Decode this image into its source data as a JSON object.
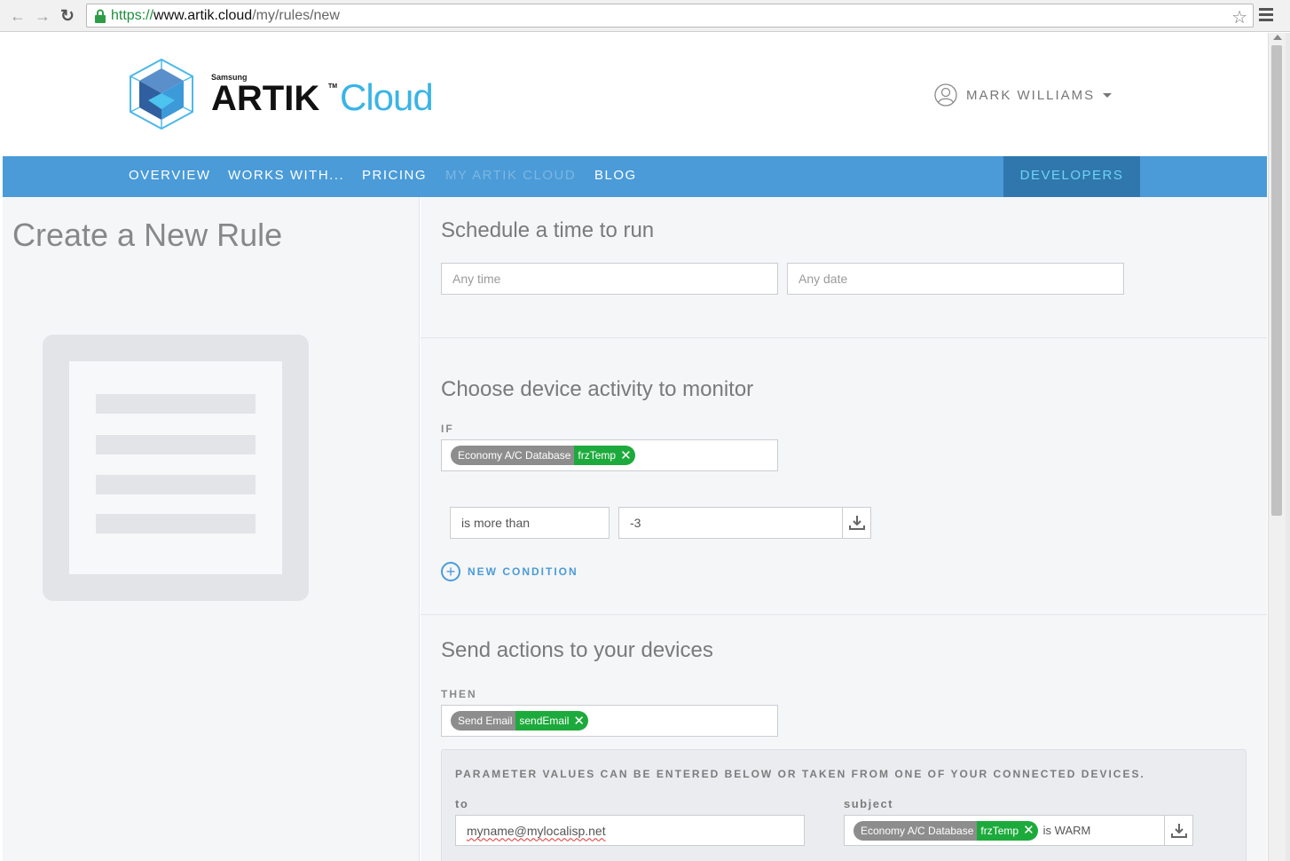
{
  "browser": {
    "url_scheme": "https://",
    "url_host": "www.artik.cloud",
    "url_path": "/my/rules/new"
  },
  "header": {
    "brand_samsung": "Samsung",
    "brand_artik": "ARTIK",
    "brand_tm": "TM",
    "brand_cloud": "Cloud",
    "user_name": "MARK WILLIAMS"
  },
  "nav": {
    "items": [
      "OVERVIEW",
      "WORKS WITH...",
      "PRICING",
      "MY ARTIK CLOUD",
      "BLOG"
    ],
    "active": "MY ARTIK CLOUD",
    "developers": "DEVELOPERS"
  },
  "left": {
    "page_title": "Create a New Rule"
  },
  "schedule": {
    "title": "Schedule a time to run",
    "time_placeholder": "Any time",
    "date_placeholder": "Any date"
  },
  "monitor": {
    "title": "Choose device activity to monitor",
    "if_label": "IF",
    "device": "Economy A/C Database",
    "field": "frzTemp",
    "operator": "is more than",
    "value": "-3",
    "new_condition": "NEW CONDITION"
  },
  "actions": {
    "title": "Send actions to your devices",
    "then_label": "THEN",
    "device": "Send Email",
    "action": "sendEmail",
    "param_note": "PARAMETER VALUES CAN BE ENTERED BELOW OR TAKEN FROM ONE OF YOUR CONNECTED DEVICES.",
    "to_label": "to",
    "to_value": "myname@mylocalisp.net",
    "subject_label": "subject",
    "subject_device": "Economy A/C Database",
    "subject_field": "frzTemp",
    "subject_suffix": "is WARM"
  },
  "colors": {
    "nav_bg": "#4a9bd8",
    "developers_bg": "#2f77ad",
    "chip_green": "#1daa3c",
    "chip_grey": "#8d8d8d",
    "brand_cloud": "#3ab4e6"
  },
  "icons": [
    "back-icon",
    "forward-icon",
    "reload-icon",
    "lock-icon",
    "star-icon",
    "menu-icon",
    "cube-logo-icon",
    "user-icon",
    "caret-down-icon",
    "close-icon",
    "download-icon",
    "plus-circle-icon"
  ]
}
